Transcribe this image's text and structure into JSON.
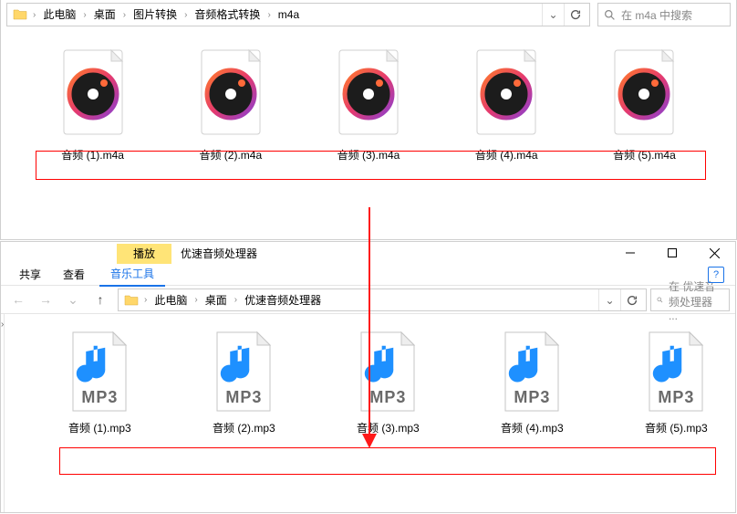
{
  "top": {
    "breadcrumb": [
      "此电脑",
      "桌面",
      "图片转换",
      "音频格式转换",
      "m4a"
    ],
    "search_placeholder": "在 m4a 中搜索",
    "files": [
      "音频 (1).m4a",
      "音频 (2).m4a",
      "音频 (3).m4a",
      "音频 (4).m4a",
      "音频 (5).m4a"
    ]
  },
  "bottom": {
    "tab_play": "播放",
    "app_title": "优速音频处理器",
    "menu": {
      "share": "共享",
      "view": "查看",
      "music": "音乐工具"
    },
    "breadcrumb": [
      "此电脑",
      "桌面",
      "优速音频处理器"
    ],
    "search_placeholder": "在 优速音频处理器 ...",
    "file_format": "MP3",
    "files": [
      "音频 (1).mp3",
      "音频 (2).mp3",
      "音频 (3).mp3",
      "音频 (4).mp3",
      "音频 (5).mp3"
    ]
  }
}
